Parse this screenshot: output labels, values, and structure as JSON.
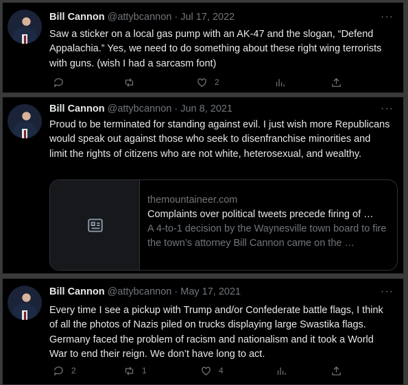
{
  "tweets": [
    {
      "name": "Bill Cannon",
      "handle": "@attybcannon",
      "date": "Jul 17, 2022",
      "text": "Saw a sticker on a local gas pump with an AK-47 and the slogan, “Defend Appalachia.”  Yes, we need to do something about these right wing terrorists with guns. (wish I had a sarcasm font)",
      "replies": "",
      "retweets": "",
      "likes": "2"
    },
    {
      "name": "Bill Cannon",
      "handle": "@attybcannon",
      "date": "Jun 8, 2021",
      "text": "Proud to be terminated for standing against evil.  I just wish more Republicans would speak out against those who seek to disenfranchise minorities and limit the rights of citizens who are not white, heterosexual, and wealthy.",
      "card": {
        "domain": "themountaineer.com",
        "title": "Complaints over political tweets precede firing of …",
        "description": "A 4-to-1 decision by the Waynesville town board to fire the town’s attorney Bill Cannon came on the …"
      }
    },
    {
      "name": "Bill Cannon",
      "handle": "@attybcannon",
      "date": "May 17, 2021",
      "text": "Every time I see a pickup with Trump and/or Confederate battle flags, I think of all the photos of Nazis piled on trucks displaying large Swastika flags.  Germany faced the problem of racism and nationalism and it took a World War to end their reign.  We don’t have long to act.",
      "replies": "2",
      "retweets": "1",
      "likes": "4"
    }
  ],
  "separator": "·",
  "more_label": "···",
  "icons": [
    "reply-icon",
    "retweet-icon",
    "like-icon",
    "views-icon",
    "share-icon",
    "article-icon"
  ],
  "colors": {
    "background": "#000000",
    "text": "#e7e9ea",
    "muted": "#71767b",
    "border": "#2f3336"
  }
}
